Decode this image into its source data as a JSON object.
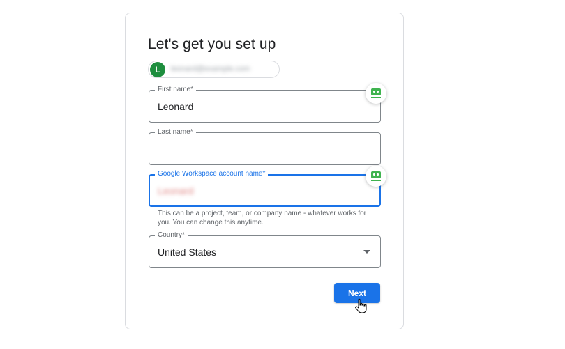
{
  "page": {
    "title": "Let's get you set up"
  },
  "account": {
    "avatar_initial": "L",
    "avatar_color": "#1e8e3e",
    "email": "leonard@example.com"
  },
  "form": {
    "first_name": {
      "label": "First name*",
      "value": "Leonard"
    },
    "last_name": {
      "label": "Last name*",
      "value": ""
    },
    "workspace_name": {
      "label": "Google Workspace account name*",
      "value": "Leonard",
      "helper": "This can be a project, team, or company name - whatever works for you. You can change this anytime."
    },
    "country": {
      "label": "Country*",
      "value": "United States"
    }
  },
  "actions": {
    "next_label": "Next"
  },
  "icons": {
    "password_manager": "password-manager-icon",
    "dropdown": "chevron-down-icon",
    "cursor": "hand-pointer-cursor"
  },
  "colors": {
    "accent": "#1a73e8",
    "password_manager": "#3fb34f",
    "border": "#80868b"
  }
}
